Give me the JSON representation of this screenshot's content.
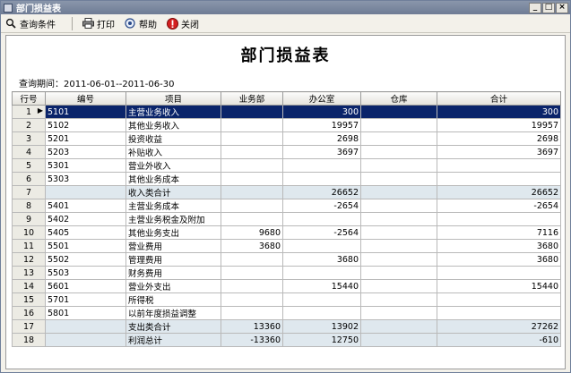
{
  "window": {
    "title": "部门损益表",
    "buttons": [
      "_",
      "□",
      "×"
    ]
  },
  "toolbar": {
    "query_label": "查询条件",
    "print_label": "打印",
    "help_label": "帮助",
    "close_label": "关闭"
  },
  "report": {
    "title": "部门损益表",
    "period": "查询期间：2011-06-01--2011-06-30",
    "columns": [
      "行号",
      "编号",
      "项目",
      "业务部",
      "办公室",
      "仓库",
      "合计"
    ],
    "rows": [
      {
        "no": "1",
        "code": "5101",
        "item": "主营业务收入",
        "sales": "",
        "office": "300",
        "warehouse": "",
        "total": "300"
      },
      {
        "no": "2",
        "code": "5102",
        "item": "其他业务收入",
        "sales": "",
        "office": "19957",
        "warehouse": "",
        "total": "19957"
      },
      {
        "no": "3",
        "code": "5201",
        "item": "投资收益",
        "sales": "",
        "office": "2698",
        "warehouse": "",
        "total": "2698"
      },
      {
        "no": "4",
        "code": "5203",
        "item": "补贴收入",
        "sales": "",
        "office": "3697",
        "warehouse": "",
        "total": "3697"
      },
      {
        "no": "5",
        "code": "5301",
        "item": "营业外收入",
        "sales": "",
        "office": "",
        "warehouse": "",
        "total": ""
      },
      {
        "no": "6",
        "code": "5303",
        "item": "其他业务成本",
        "sales": "",
        "office": "",
        "warehouse": "",
        "total": ""
      },
      {
        "no": "7",
        "code": "",
        "item": "收入类合计",
        "sales": "",
        "office": "26652",
        "warehouse": "",
        "total": "26652"
      },
      {
        "no": "8",
        "code": "5401",
        "item": "主营业务成本",
        "sales": "",
        "office": "-2654",
        "warehouse": "",
        "total": "-2654"
      },
      {
        "no": "9",
        "code": "5402",
        "item": "主营业务税金及附加",
        "sales": "",
        "office": "",
        "warehouse": "",
        "total": ""
      },
      {
        "no": "10",
        "code": "5405",
        "item": "其他业务支出",
        "sales": "9680",
        "office": "-2564",
        "warehouse": "",
        "total": "7116"
      },
      {
        "no": "11",
        "code": "5501",
        "item": "营业费用",
        "sales": "3680",
        "office": "",
        "warehouse": "",
        "total": "3680"
      },
      {
        "no": "12",
        "code": "5502",
        "item": "管理费用",
        "sales": "",
        "office": "3680",
        "warehouse": "",
        "total": "3680"
      },
      {
        "no": "13",
        "code": "5503",
        "item": "财务费用",
        "sales": "",
        "office": "",
        "warehouse": "",
        "total": ""
      },
      {
        "no": "14",
        "code": "5601",
        "item": "营业外支出",
        "sales": "",
        "office": "15440",
        "warehouse": "",
        "total": "15440"
      },
      {
        "no": "15",
        "code": "5701",
        "item": "所得税",
        "sales": "",
        "office": "",
        "warehouse": "",
        "total": ""
      },
      {
        "no": "16",
        "code": "5801",
        "item": "以前年度损益调整",
        "sales": "",
        "office": "",
        "warehouse": "",
        "total": ""
      },
      {
        "no": "17",
        "code": "",
        "item": "支出类合计",
        "sales": "13360",
        "office": "13902",
        "warehouse": "",
        "total": "27262"
      },
      {
        "no": "18",
        "code": "",
        "item": "利润总计",
        "sales": "-13360",
        "office": "12750",
        "warehouse": "",
        "total": "-610"
      }
    ]
  },
  "colors": {
    "selection": "#0a246a",
    "subtotal_row": "#dfe8ee",
    "close_icon": "#d42020"
  },
  "icons": [
    "query-icon",
    "print-icon",
    "help-icon",
    "close-icon"
  ]
}
